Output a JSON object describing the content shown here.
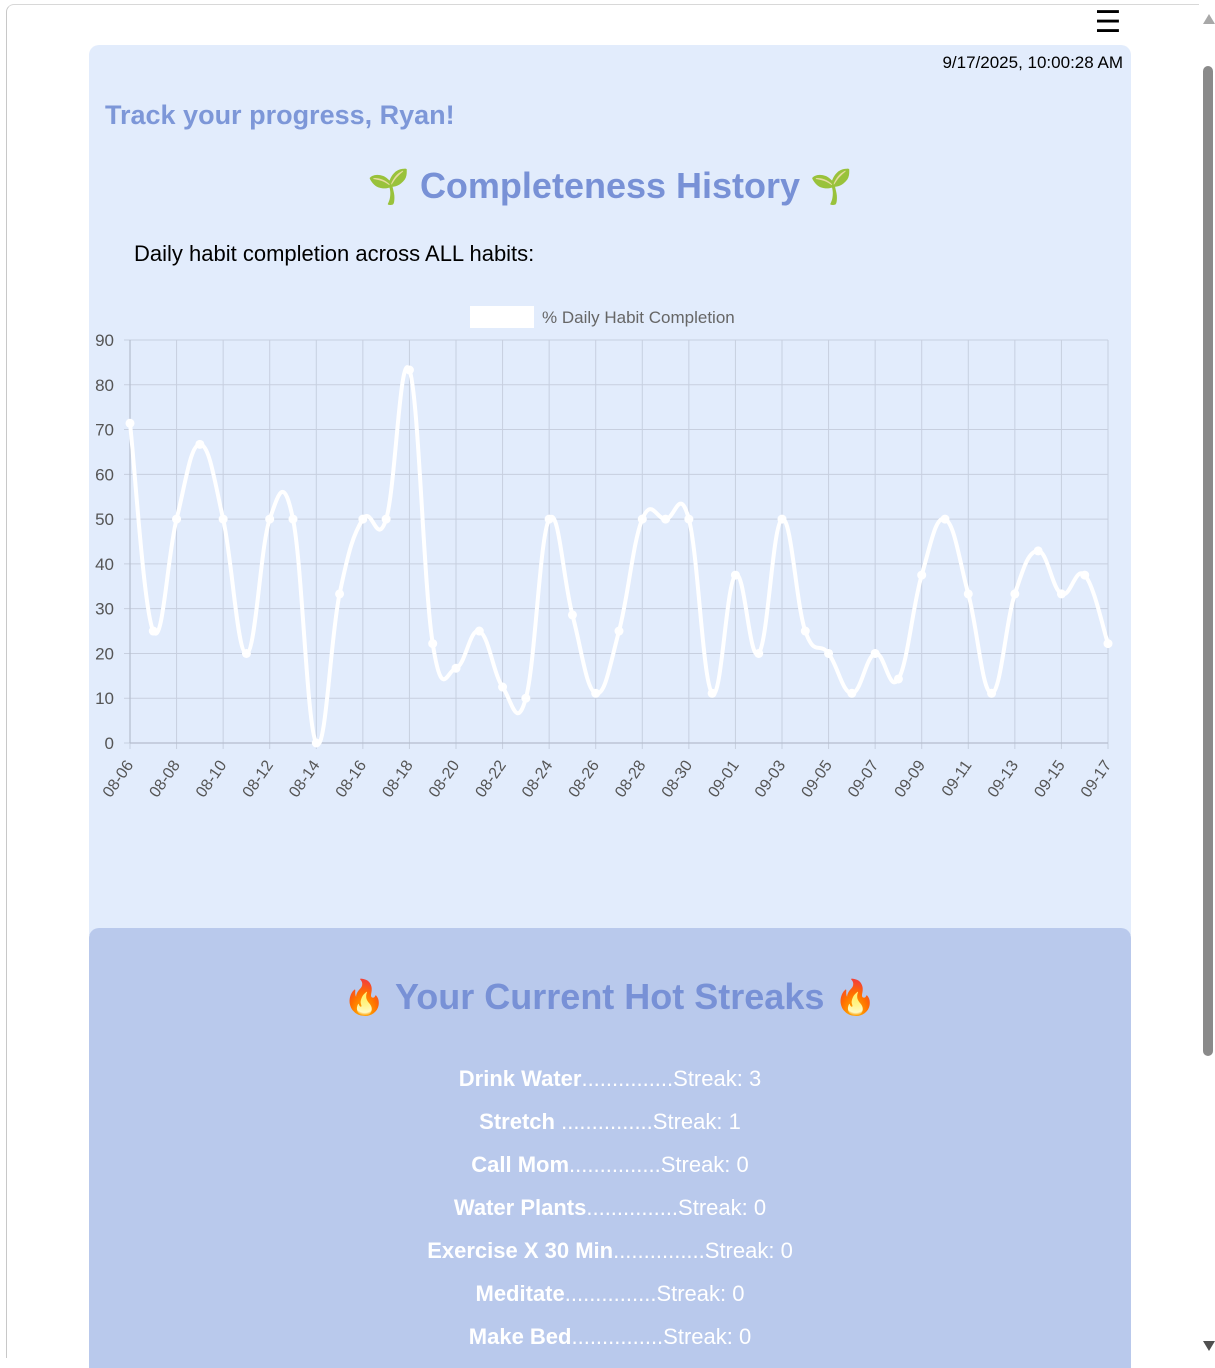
{
  "header": {
    "menu_icon": "☰"
  },
  "timestamp": "9/17/2025, 10:00:28 AM",
  "greeting": "Track your progress, Ryan!",
  "history": {
    "title": "Completeness History",
    "title_emoji": "🌱",
    "caption": "Daily habit completion across ALL habits:"
  },
  "chart_data": {
    "type": "line",
    "legend": [
      "% Daily Habit Completion"
    ],
    "legend_position": "top",
    "grid": true,
    "line_color": "#ffffff",
    "x": [
      "08-06",
      "08-07",
      "08-08",
      "08-09",
      "08-10",
      "08-11",
      "08-12",
      "08-13",
      "08-14",
      "08-15",
      "08-16",
      "08-17",
      "08-18",
      "08-19",
      "08-20",
      "08-21",
      "08-22",
      "08-23",
      "08-24",
      "08-25",
      "08-26",
      "08-27",
      "08-28",
      "08-29",
      "08-30",
      "08-31",
      "09-01",
      "09-02",
      "09-03",
      "09-04",
      "09-05",
      "09-06",
      "09-07",
      "09-08",
      "09-09",
      "09-10",
      "09-11",
      "09-12",
      "09-13",
      "09-14",
      "09-15",
      "09-16",
      "09-17"
    ],
    "x_tick_labels": [
      "08-06",
      "08-08",
      "08-10",
      "08-12",
      "08-14",
      "08-16",
      "08-18",
      "08-20",
      "08-22",
      "08-24",
      "08-26",
      "08-28",
      "08-30",
      "09-01",
      "09-03",
      "09-05",
      "09-07",
      "09-09",
      "09-11",
      "09-13",
      "09-15",
      "09-17"
    ],
    "series": [
      {
        "name": "% Daily Habit Completion",
        "values": [
          71.4,
          25,
          50,
          66.7,
          50,
          20,
          50,
          50,
          0,
          33.3,
          50,
          50,
          83.3,
          22.2,
          16.7,
          25,
          12.5,
          10,
          50,
          28.6,
          11.1,
          25,
          50,
          50,
          50,
          11.1,
          37.5,
          20,
          50,
          25,
          20,
          11.1,
          20,
          14.3,
          37.5,
          50,
          33.3,
          11.1,
          33.3,
          42.9,
          33.3,
          37.5,
          22.2
        ]
      }
    ],
    "y_ticks": [
      0,
      10,
      20,
      30,
      40,
      50,
      60,
      70,
      80,
      90
    ],
    "ylim": [
      0,
      90
    ]
  },
  "streaks": {
    "title": "Your Current Hot Streaks",
    "title_emoji": "🔥",
    "dots": "...............",
    "items": [
      {
        "name": "Drink Water",
        "streak": "Streak: 3"
      },
      {
        "name": "Stretch ",
        "streak": "Streak: 1"
      },
      {
        "name": "Call Mom",
        "streak": "Streak: 0"
      },
      {
        "name": "Water Plants",
        "streak": "Streak: 0"
      },
      {
        "name": "Exercise X 30 Min",
        "streak": "Streak: 0"
      },
      {
        "name": "Meditate",
        "streak": "Streak: 0"
      },
      {
        "name": "Make Bed",
        "streak": "Streak: 0"
      }
    ]
  }
}
